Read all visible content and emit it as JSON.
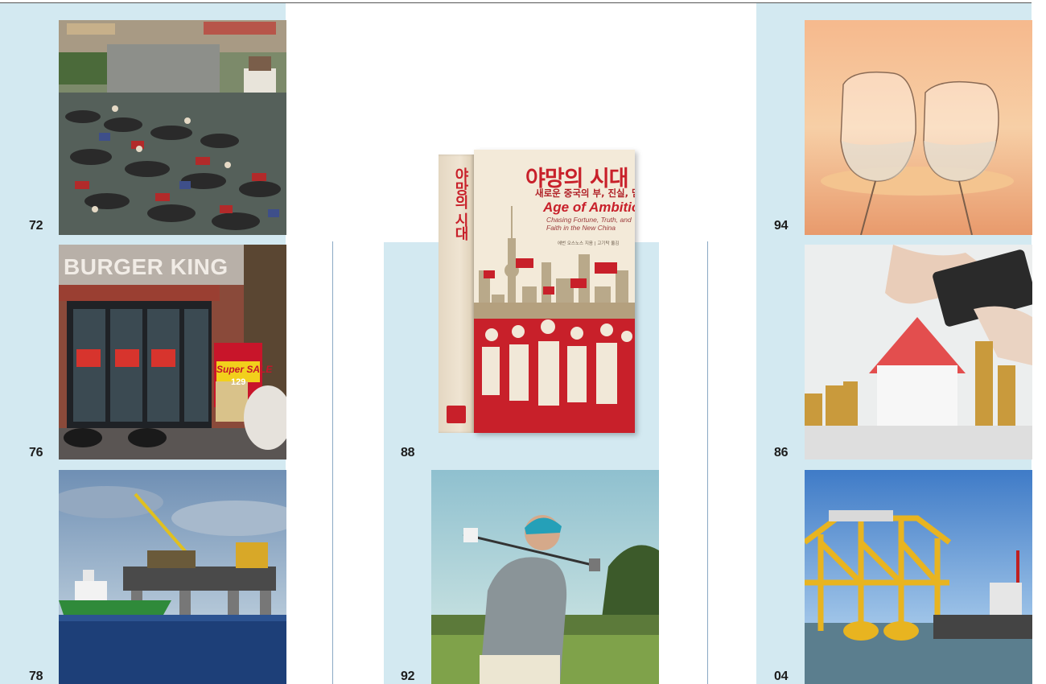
{
  "page_numbers": {
    "p1": "72",
    "p2": "76",
    "p3": "78",
    "p4": "88",
    "p5": "92",
    "p6": "94",
    "p7": "86",
    "p8": "04"
  },
  "photos": {
    "burger_sign": "BURGER KING",
    "sale_banner": "Super SALE",
    "sale_price": "129"
  },
  "book": {
    "title_ko": "야망의 시대",
    "subtitle_ko": "새로운 중국의 부, 진실, 믿음",
    "title_en": "Age of Ambition",
    "subtitle_en": "Chasing Fortune, Truth, and Faith in the New China",
    "author_line": "에번 오스노스 지음 | 고기탁 옮김"
  },
  "colors": {
    "band": "#d3e9f1",
    "book_red": "#c8202a",
    "divider": "#8aa9c4"
  }
}
